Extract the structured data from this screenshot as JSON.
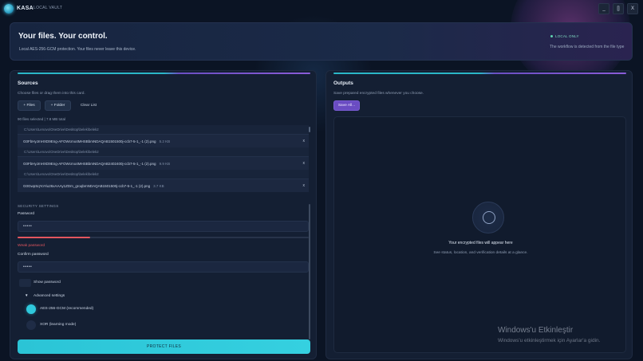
{
  "app": {
    "name": "KASA",
    "subtitle": "LOCAL VAULT"
  },
  "window_controls": {
    "minimize": "_",
    "maximize": "[]",
    "close": "X"
  },
  "hero": {
    "title": "Your files. Your control.",
    "description": "Local AES-256-GCM protection. Your files never leave this device.",
    "badge": "LOCAL ONLY",
    "note": "The workflow is detected from the file type"
  },
  "sources": {
    "title": "Sources",
    "description": "Choose files or drag them into this card.",
    "buttons": {
      "files": "+ Files",
      "folder": "+ Folder",
      "clear": "Clear List"
    },
    "count_text": "90 files selected  |  7.8 MB total",
    "strength": 0.25,
    "items": [
      {
        "path": "C:\\Users\\Lenovo\\OneDrive\\Desktop\\belek\\belek2",
        "name": "G0FbHyJmHXD9Eng-AFOWcmo4MHSBbmNDAQAB1501500j-ccb7-5-1_-1 (2).png",
        "size": "5.2 KB"
      },
      {
        "path": "C:\\Users\\Lenovo\\OneDrive\\Desktop\\belek\\belek2",
        "name": "G0FbHyJmHXD9Eng-AFOWcmo4MHSBbmNDAQAB2402400j-ccb7-5-1_-1 (2).png",
        "size": "9.9 KB"
      },
      {
        "path": "C:\\Users\\Lenovo\\OneDrive\\Desktop\\belek\\belek2",
        "name": "G0GwpSqYoYiu26xAAAy1ZDm_groqbmNDAQAB1501500j-ccb7-5-1_-1 (2).png",
        "size": "3.7 KB"
      }
    ],
    "remove_glyph": "x"
  },
  "security": {
    "section_label": "SECURITY SETTINGS",
    "password_label": "Password",
    "password_value": "•••••",
    "strength_text": "Weak password",
    "confirm_label": "Confirm password",
    "confirm_value": "•••••",
    "show_password": "Show password",
    "advanced_label": "Advanced settings",
    "advanced_glyph": "▼",
    "options": [
      {
        "label": "AES-256-GCM (recommended)",
        "selected": true
      },
      {
        "label": "XOR (learning mode)",
        "selected": false
      }
    ],
    "protect_button": "PROTECT FILES"
  },
  "outputs": {
    "title": "Outputs",
    "description": "Save prepared encrypted files whenever you choose.",
    "save_all": "Save All...",
    "empty_title": "Your encrypted files will appear here",
    "empty_desc": "See status, location, and verification details at a glance."
  },
  "watermark": {
    "title": "Windows'u Etkinleştir",
    "subtitle": "Windows'u etkinleştirmek için Ayarlar'a gidin."
  },
  "colors": {
    "accent": "#2bc4d6",
    "purple": "#6a4cc2",
    "danger": "#e2565f",
    "background": "#0b1424"
  }
}
